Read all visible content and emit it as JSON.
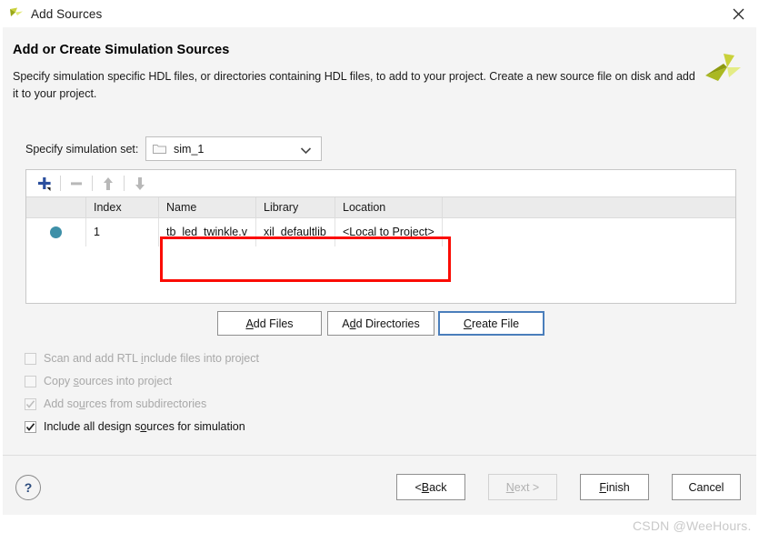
{
  "window": {
    "title": "Add Sources",
    "icon": "vivado-logo-icon",
    "close_label": "✕"
  },
  "header": {
    "title": "Add or Create Simulation Sources",
    "description": "Specify simulation specific HDL files, or directories containing HDL files, to add to your project. Create a new source file on disk and add it to your project.",
    "logo": "xilinx-logo-icon"
  },
  "simulation_set": {
    "label": "Specify simulation set:",
    "icon": "folder-icon",
    "value": "sim_1",
    "options": [
      "sim_1"
    ],
    "chevron": "chevron-down-icon"
  },
  "table_toolbar": {
    "add_label": "+",
    "remove_label": "−",
    "move_up_label": "move-up",
    "move_down_label": "move-down"
  },
  "sources_table": {
    "columns": [
      "",
      "Index",
      "Name",
      "Library",
      "Location"
    ],
    "rows": [
      {
        "status": "●",
        "index": "1",
        "name": "tb_led_twinkle.v",
        "library": "xil_defaultlib",
        "location": "<Local to Project>"
      }
    ]
  },
  "actions": {
    "add_files": {
      "pre": "A",
      "mnemonic": "",
      "text": "Add Files"
    },
    "add_files_parts": [
      "A",
      "dd Files"
    ],
    "add_directories_parts": [
      "A",
      "d",
      "d Directories"
    ],
    "create_file_parts": [
      "C",
      "reate File"
    ]
  },
  "checkboxes": [
    {
      "checked": false,
      "enabled": false,
      "parts": [
        "Scan and add RTL ",
        "i",
        "nclude files into project"
      ]
    },
    {
      "checked": false,
      "enabled": false,
      "parts": [
        "Copy ",
        "s",
        "ources into project"
      ]
    },
    {
      "checked": true,
      "enabled": false,
      "parts": [
        "Add so",
        "u",
        "rces from subdirectories"
      ]
    },
    {
      "checked": true,
      "enabled": true,
      "parts": [
        "Include all design s",
        "o",
        "urces for simulation"
      ]
    }
  ],
  "footer": {
    "help_label": "?",
    "back_parts": [
      "< ",
      "B",
      "ack"
    ],
    "next_parts": [
      "",
      "N",
      "ext >"
    ],
    "finish_parts": [
      "",
      "F",
      "inish"
    ],
    "cancel_label": "Cancel"
  },
  "watermark": {
    "text": "CSDN @WeeHours."
  },
  "colors": {
    "accent_blue": "#4a7ebb",
    "status_teal": "#3e90a8",
    "annotation_red": "#fb0c04",
    "body_bg": "#f4f4f4",
    "logo_green": "#b5c334"
  }
}
